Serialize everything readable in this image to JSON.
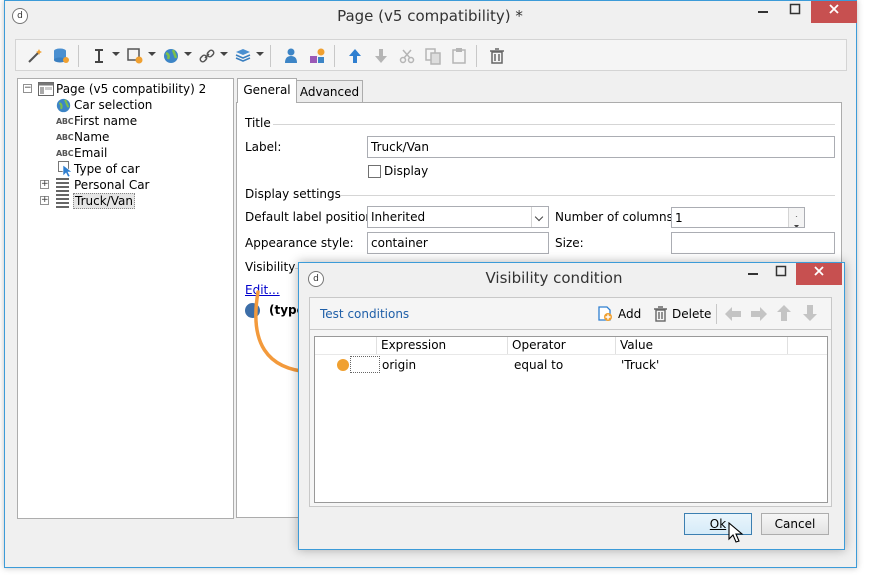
{
  "main_window": {
    "title": "Page (v5 compatibility) *",
    "logo_letter": "d"
  },
  "tree": {
    "root_label": "Page (v5 compatibility) 2",
    "items": [
      {
        "label": "Car selection",
        "icon": "globe-icon"
      },
      {
        "label": "First name",
        "icon": "abc-icon"
      },
      {
        "label": "Name",
        "icon": "abc-icon"
      },
      {
        "label": "Email",
        "icon": "abc-icon"
      },
      {
        "label": "Type of car",
        "icon": "cursor-icon"
      },
      {
        "label": "Personal Car",
        "icon": "list-icon"
      },
      {
        "label": "Truck/Van",
        "icon": "list-icon"
      }
    ],
    "abc_text": "ABC",
    "expand_glyph": "+",
    "collapse_glyph": "−"
  },
  "tabs": {
    "general": "General",
    "advanced": "Advanced"
  },
  "general": {
    "title_group": "Title",
    "label_label": "Label:",
    "label_value": "Truck/Van",
    "display_label": "Display",
    "display_checked": false,
    "display_settings_group": "Display settings",
    "default_label_position_label": "Default label position:",
    "default_label_position_value": "Inherited",
    "number_of_columns_label": "Number of columns:",
    "number_of_columns_value": "1",
    "appearance_style_label": "Appearance style:",
    "appearance_style_value": "container",
    "size_label": "Size:",
    "size_value": "",
    "visibility_group": "Visibility",
    "edit_link": "Edit...",
    "condition_preview": "(type"
  },
  "dialog": {
    "title": "Visibility condition",
    "test_conditions": "Test conditions",
    "add_label": "Add",
    "delete_label": "Delete",
    "columns": [
      "Expression",
      "Operator",
      "Value"
    ],
    "rows": [
      {
        "expression": "origin",
        "operator": "equal to",
        "value": "'Truck'"
      }
    ],
    "ok_label": "Ok",
    "cancel_label": "Cancel"
  },
  "colors": {
    "accent": "#3c9bd8",
    "close": "#c75050",
    "arrow": "#f39a3c",
    "row_marker": "#f0a030"
  }
}
